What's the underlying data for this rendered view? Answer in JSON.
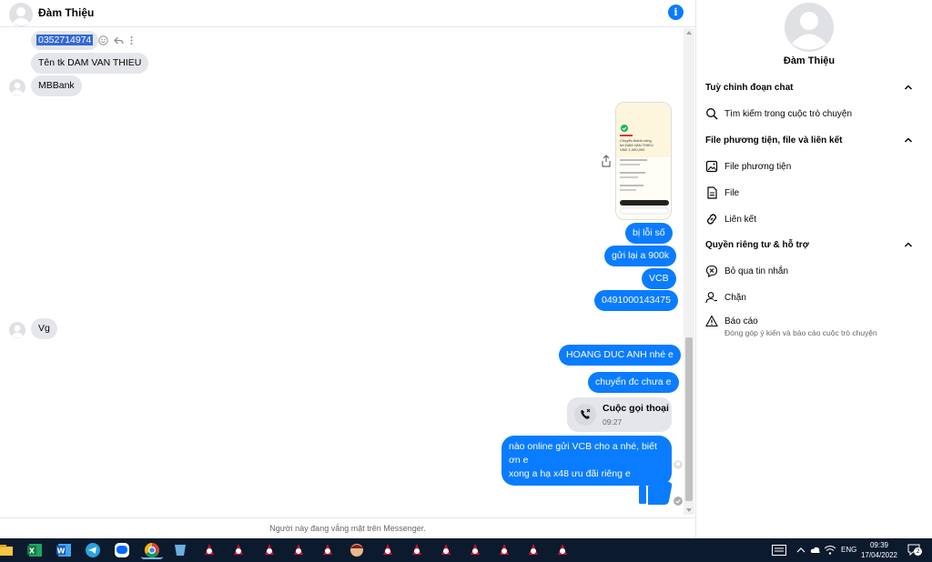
{
  "header": {
    "contact_name": "Đàm Thiệu",
    "info_icon": "info-icon",
    "info_glyph": "i"
  },
  "messages": {
    "m1": {
      "text": "0352714974"
    },
    "m2": {
      "text": "Tên tk DAM VAN THIEU"
    },
    "m3": {
      "text": "MBBank"
    },
    "m4": {
      "text": "bị lỗi số"
    },
    "m5": {
      "text": "gửi lại a 900k"
    },
    "m6": {
      "text": "VCB"
    },
    "m7": {
      "text": "0491000143475"
    },
    "m8": {
      "text": "Vg"
    },
    "m9": {
      "text": "HOANG DUC ANH nhé e"
    },
    "m10": {
      "text": "chuyển đc chưa e"
    },
    "call": {
      "title": "Cuộc gọi thoại",
      "time": "09:27"
    },
    "m11": {
      "line1": "nào online gửi VCB cho a nhé, biết ơn e",
      "line2": "xong a hạ x48 ưu đãi riêng e"
    },
    "receipt": {
      "line1": "Chuyển thành công",
      "line2": "tới DAM VAN THIEU",
      "amount": "VND 1,000,000"
    }
  },
  "footer_note": "Người này đang vắng mặt trên Messenger.",
  "panel": {
    "name": "Đàm Thiệu",
    "sections": {
      "customize": "Tuỳ chỉnh đoạn chat",
      "media": "File phương tiện, file và liên kết",
      "privacy": "Quyền riêng tư & hỗ trợ"
    },
    "items": {
      "search": "Tìm kiếm trong cuộc trò chuyện",
      "media_files": "File phương tiện",
      "files": "File",
      "links": "Liên kết",
      "ignore": "Bỏ qua tin nhắn",
      "block": "Chặn",
      "report": "Báo cáo",
      "report_sub": "Đóng góp ý kiến và báo cáo cuộc trò chuyện"
    }
  },
  "taskbar": {
    "lang": "ENG",
    "time": "09:39",
    "date": "17/04/2022",
    "notif_count": "2",
    "apps": [
      "file-explorer",
      "excel",
      "word",
      "telegram",
      "zalo",
      "chrome",
      "app",
      "game",
      "game",
      "game",
      "game",
      "game",
      "game",
      "game",
      "game",
      "game",
      "game",
      "game"
    ]
  },
  "colors": {
    "accent": "#0a7cff",
    "bubble_in": "#e4e6eb",
    "taskbar": "#0c1a2e"
  }
}
